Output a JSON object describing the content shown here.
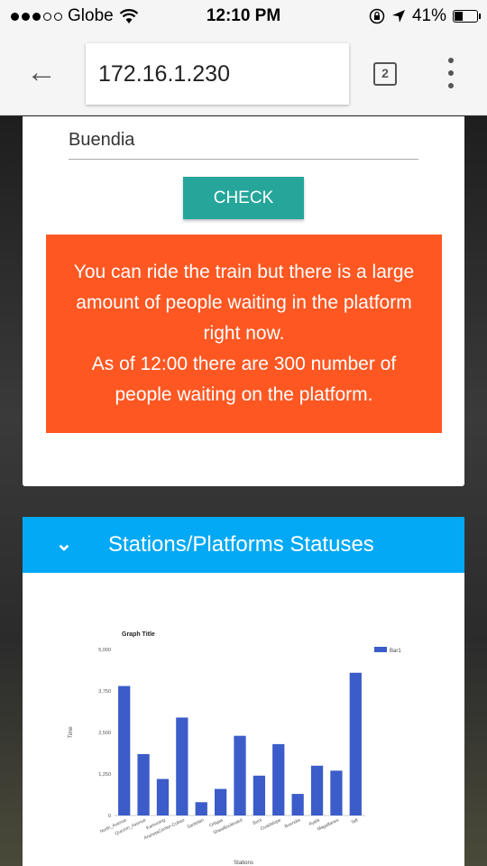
{
  "status_bar": {
    "carrier": "Globe",
    "time": "12:10 PM",
    "battery": "41%",
    "battery_level": 0.41
  },
  "browser": {
    "url": "172.16.1.230",
    "tab_count": "2"
  },
  "form": {
    "station_value": "Buendia",
    "check_label": "CHECK"
  },
  "alert": {
    "line1": "You can ride the train but there is a large amount of people waiting in the platform right now.",
    "line2": "As of 12:00 there are 300 number of people waiting on the platform."
  },
  "stations_panel": {
    "title": "Stations/Platforms Statuses"
  },
  "chart_data": {
    "type": "bar",
    "title": "Graph Title",
    "xlabel": "Stations",
    "ylabel": "Time",
    "ylim": [
      0,
      5000
    ],
    "yticks": [
      "0",
      "1,250",
      "2,500",
      "3,750",
      "5,000"
    ],
    "grid": false,
    "legend_position": "top-right",
    "categories": [
      "North_Avenue",
      "Quezon_Avenue",
      "Kamuning",
      "AranetaCenter-Cubao",
      "Santolan",
      "Ortigas",
      "ShawBoulevard",
      "Boni",
      "Guadalupe",
      "Buendia",
      "Ayala",
      "Magallanes",
      "Taft"
    ],
    "series": [
      {
        "name": "Bar1",
        "color": "#3b5cc9",
        "values": [
          3900,
          1850,
          1100,
          2950,
          400,
          800,
          2400,
          1200,
          2150,
          650,
          1500,
          1350,
          4300
        ]
      }
    ]
  }
}
